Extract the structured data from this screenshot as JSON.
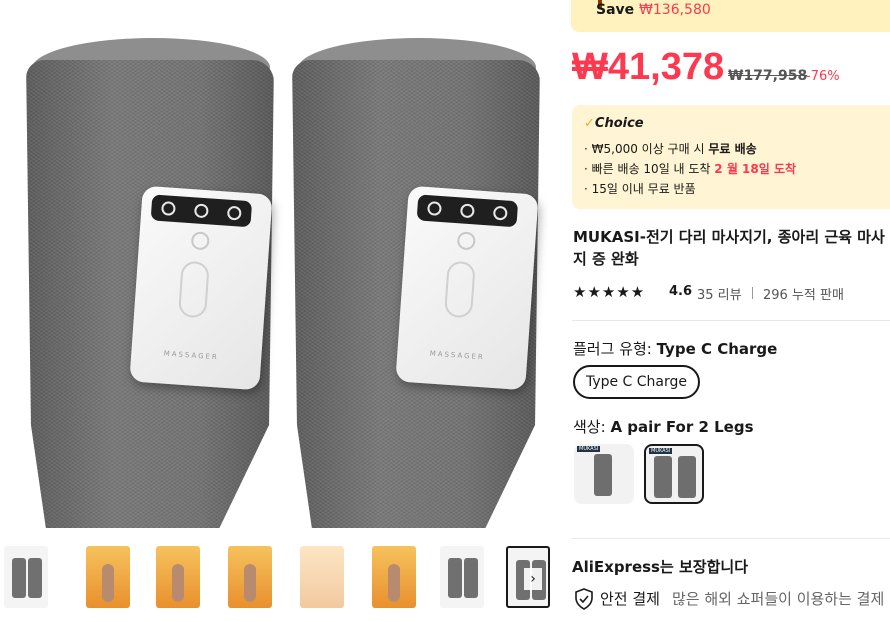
{
  "save": {
    "label": "Save",
    "amount": "₩136,580"
  },
  "price": {
    "current": "₩41,378",
    "original": "₩177,958",
    "discount": "-76%"
  },
  "choice": {
    "label": "Choice",
    "benefits": [
      {
        "prefix": "· ₩5,000 이상 구매 시 ",
        "strong": "무료 배송",
        "suffix": ""
      },
      {
        "prefix": "· 빠른 배송 10일 내 도착 ",
        "strong": "2 월 18일 도착",
        "suffix": ""
      },
      {
        "prefix": "· ",
        "strong": "15일 이내  무료 반품",
        "suffix": ""
      }
    ]
  },
  "product": {
    "title": "MUKASI-전기 다리 마사지기, 종아리 근육 마사지 증 완화",
    "stars": "★★★★★",
    "rating": "4.6",
    "reviews": "35 리뷰",
    "sold": "296 누적 판매"
  },
  "plug": {
    "label": "플러그 유형:",
    "value": "Type C Charge",
    "option": "Type C Charge"
  },
  "color": {
    "label": "색상:",
    "value": "A pair For 2 Legs"
  },
  "device": {
    "brand_text": "MASSAGER",
    "swatch_tag": "MUKASI"
  },
  "guarantee": {
    "title": "AliExpress는 보장합니다",
    "secure": "안전 결제",
    "secure_desc": "많은 해외 쇼퍼들이 이용하는 결제"
  },
  "thumbs_next": "›"
}
